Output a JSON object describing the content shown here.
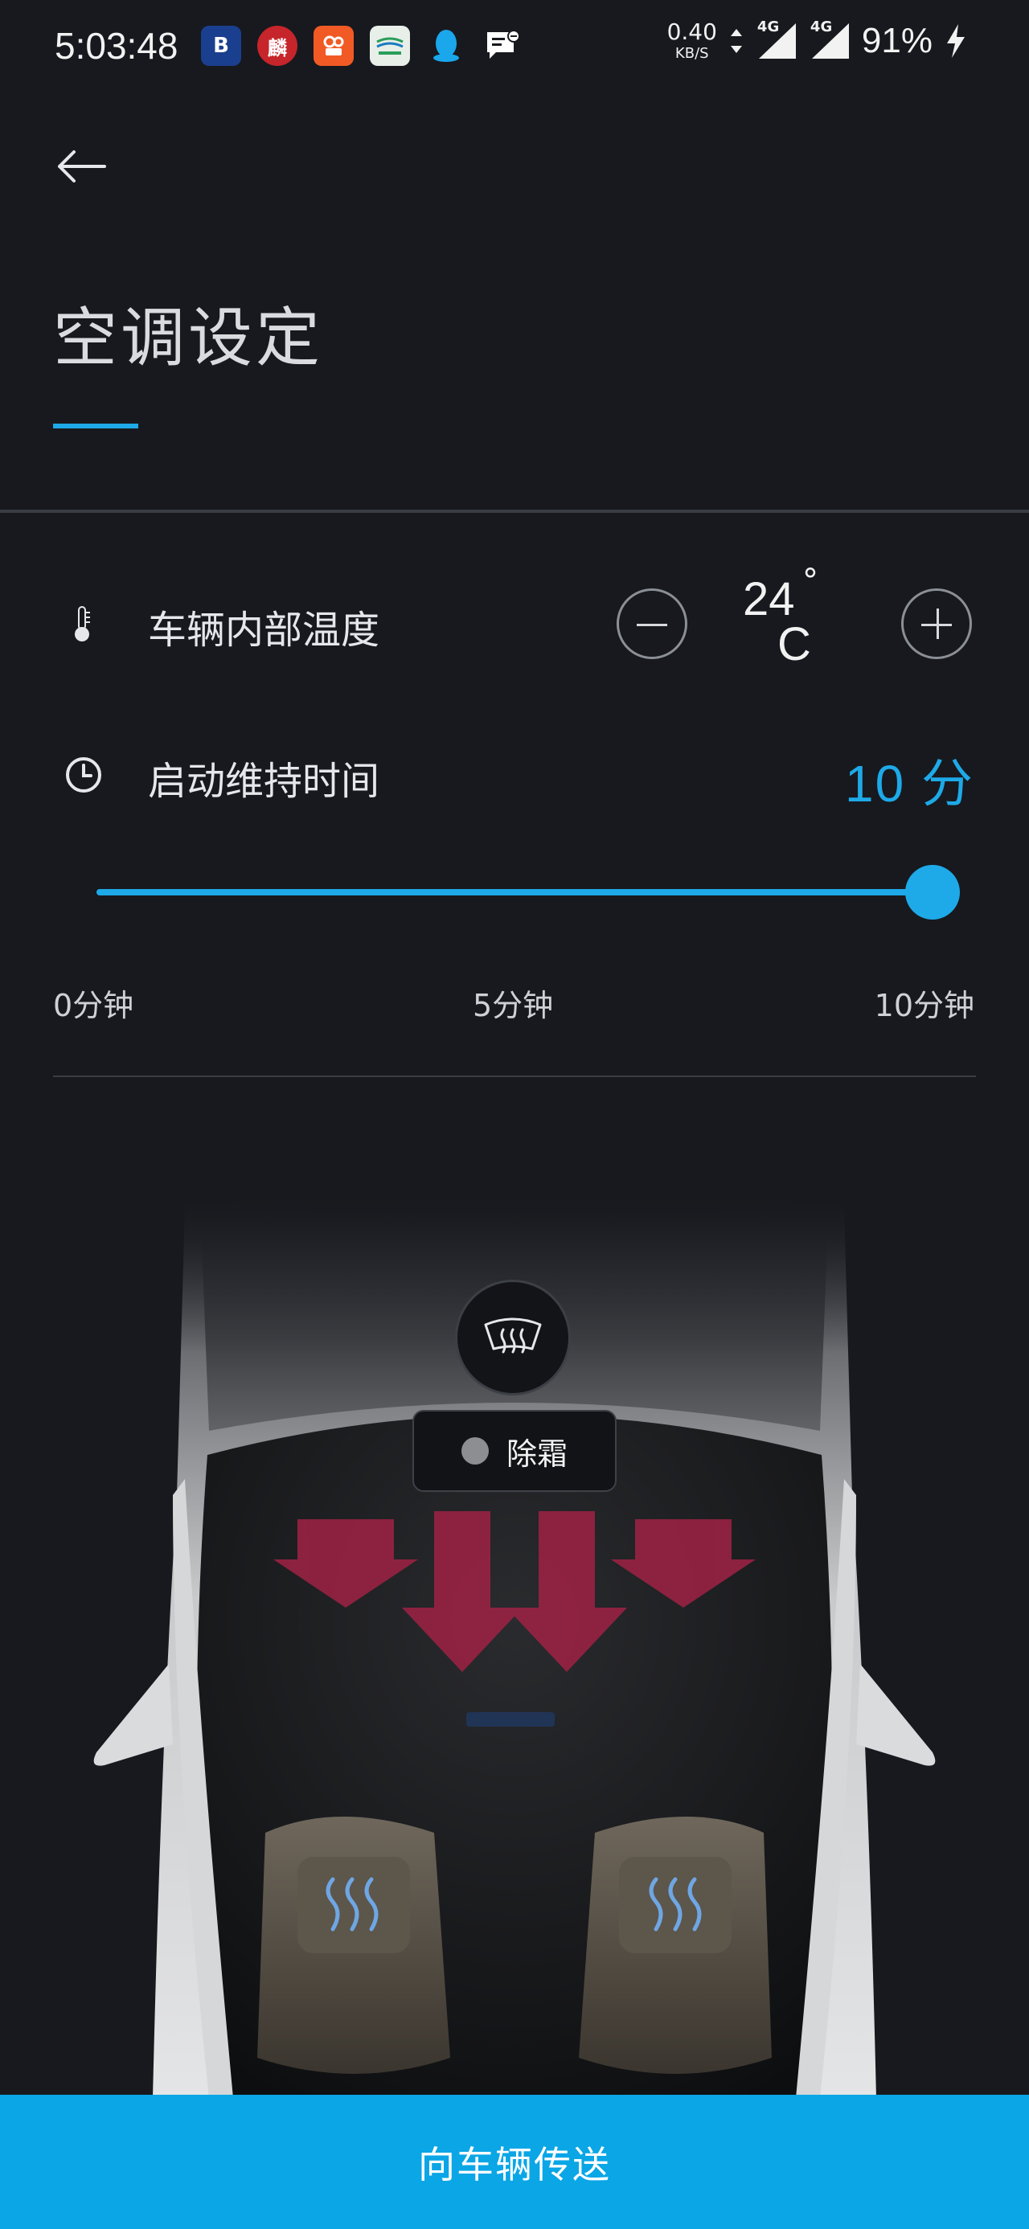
{
  "status_bar": {
    "time": "5:03:48",
    "notification_icons": [
      {
        "name": "bluetooth-app-icon",
        "label": "B",
        "color": "#1b3f8f"
      },
      {
        "name": "news-app-icon",
        "label": "麟",
        "color": "#c6252b"
      },
      {
        "name": "camera-app-icon",
        "label": "",
        "color": "#f15a24"
      },
      {
        "name": "transit-app-icon",
        "label": "",
        "color": "#e8efe9"
      },
      {
        "name": "qq-icon",
        "label": "",
        "color": "#1aa7ec"
      },
      {
        "name": "message-icon",
        "label": "",
        "color": "#ffffff"
      }
    ],
    "net_speed_value": "0.40",
    "net_speed_unit": "KB/S",
    "signal_1": "4G",
    "signal_2": "4G",
    "battery": "91%"
  },
  "header": {
    "title": "空调设定",
    "accent_color": "#1ea9e8"
  },
  "temperature": {
    "label": "车辆内部温度",
    "value": "24",
    "degree": "°",
    "unit": "C"
  },
  "duration": {
    "label": "启动维持时间",
    "value": "10 分",
    "slider": {
      "min": 0,
      "max": 10,
      "current": 10,
      "ticks": [
        "0分钟",
        "5分钟",
        "10分钟"
      ]
    }
  },
  "defrost": {
    "label": "除霜",
    "icon": "windshield-defrost-icon",
    "enabled": false
  },
  "seats": {
    "left_heat_icon": "seat-heat-icon",
    "right_heat_icon": "seat-heat-icon"
  },
  "footer": {
    "send_label": "向车辆传送",
    "button_color": "#0aa6e6"
  }
}
